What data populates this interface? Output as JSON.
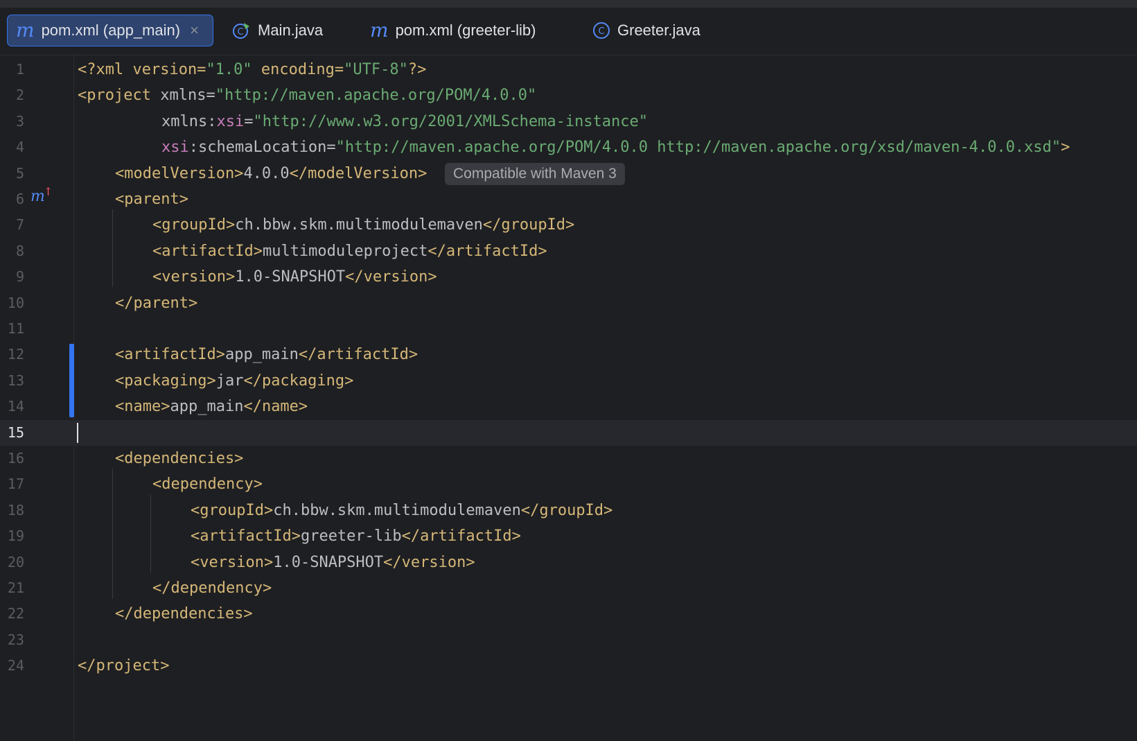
{
  "tabs": [
    {
      "label": "pom.xml (app_main)",
      "icon": "maven-m-icon",
      "active": true,
      "close": "×"
    },
    {
      "label": "Main.java",
      "icon": "java-main-class-icon",
      "active": false
    },
    {
      "label": "pom.xml (greeter-lib)",
      "icon": "maven-m-icon",
      "active": false
    },
    {
      "label": "Greeter.java",
      "icon": "java-class-icon",
      "active": false
    }
  ],
  "icons": {
    "maven": "m",
    "java_class": "C"
  },
  "editor": {
    "current_line": 15,
    "line_numbers": [
      "1",
      "2",
      "3",
      "4",
      "5",
      "6",
      "7",
      "8",
      "9",
      "10",
      "11",
      "12",
      "13",
      "14",
      "15",
      "16",
      "17",
      "18",
      "19",
      "20",
      "21",
      "22",
      "23",
      "24"
    ],
    "lines": {
      "l1": {
        "a": "<?xml version=",
        "b": "\"1.0\"",
        "c": " encoding=",
        "d": "\"UTF-8\"",
        "e": "?>"
      },
      "l2": {
        "a": "<project ",
        "b": "xmlns=",
        "c": "\"http://maven.apache.org/POM/4.0.0\""
      },
      "l3": {
        "a": "xmlns:",
        "b": "xsi",
        "c": "=",
        "d": "\"http://www.w3.org/2001/XMLSchema-instance\""
      },
      "l4": {
        "a": "xsi",
        "b": ":schemaLocation=",
        "c": "\"http://maven.apache.org/POM/4.0.0 http://maven.apache.org/xsd/maven-4.0.0.xsd\"",
        "d": ">"
      },
      "l5": {
        "open": "<modelVersion>",
        "text": "4.0.0",
        "close": "</modelVersion>",
        "hint": "Compatible with Maven 3"
      },
      "l6": {
        "tag": "<parent>",
        "gutter_mark": "m"
      },
      "l7": {
        "open": "<groupId>",
        "text": "ch.bbw.skm.multimodulemaven",
        "close": "</groupId>"
      },
      "l8": {
        "open": "<artifactId>",
        "text": "multimoduleproject",
        "close": "</artifactId>"
      },
      "l9": {
        "open": "<version>",
        "text": "1.0-SNAPSHOT",
        "close": "</version>"
      },
      "l10": {
        "tag": "</parent>"
      },
      "l12": {
        "open": "<artifactId>",
        "text": "app_main",
        "close": "</artifactId>"
      },
      "l13": {
        "open": "<packaging>",
        "text": "jar",
        "close": "</packaging>"
      },
      "l14": {
        "open": "<name>",
        "text": "app_main",
        "close": "</name>"
      },
      "l16": {
        "tag": "<dependencies>"
      },
      "l17": {
        "tag": "<dependency>"
      },
      "l18": {
        "open": "<groupId>",
        "text": "ch.bbw.skm.multimodulemaven",
        "close": "</groupId>"
      },
      "l19": {
        "open": "<artifactId>",
        "text": "greeter-lib",
        "close": "</artifactId>"
      },
      "l20": {
        "open": "<version>",
        "text": "1.0-SNAPSHOT",
        "close": "</version>"
      },
      "l21": {
        "tag": "</dependency>"
      },
      "l22": {
        "tag": "</dependencies>"
      },
      "l24": {
        "tag": "</project>"
      }
    }
  },
  "colors": {
    "tag": "#d5b778",
    "string": "#6aab73",
    "namespace": "#c77dbb",
    "accent": "#3574f0"
  }
}
